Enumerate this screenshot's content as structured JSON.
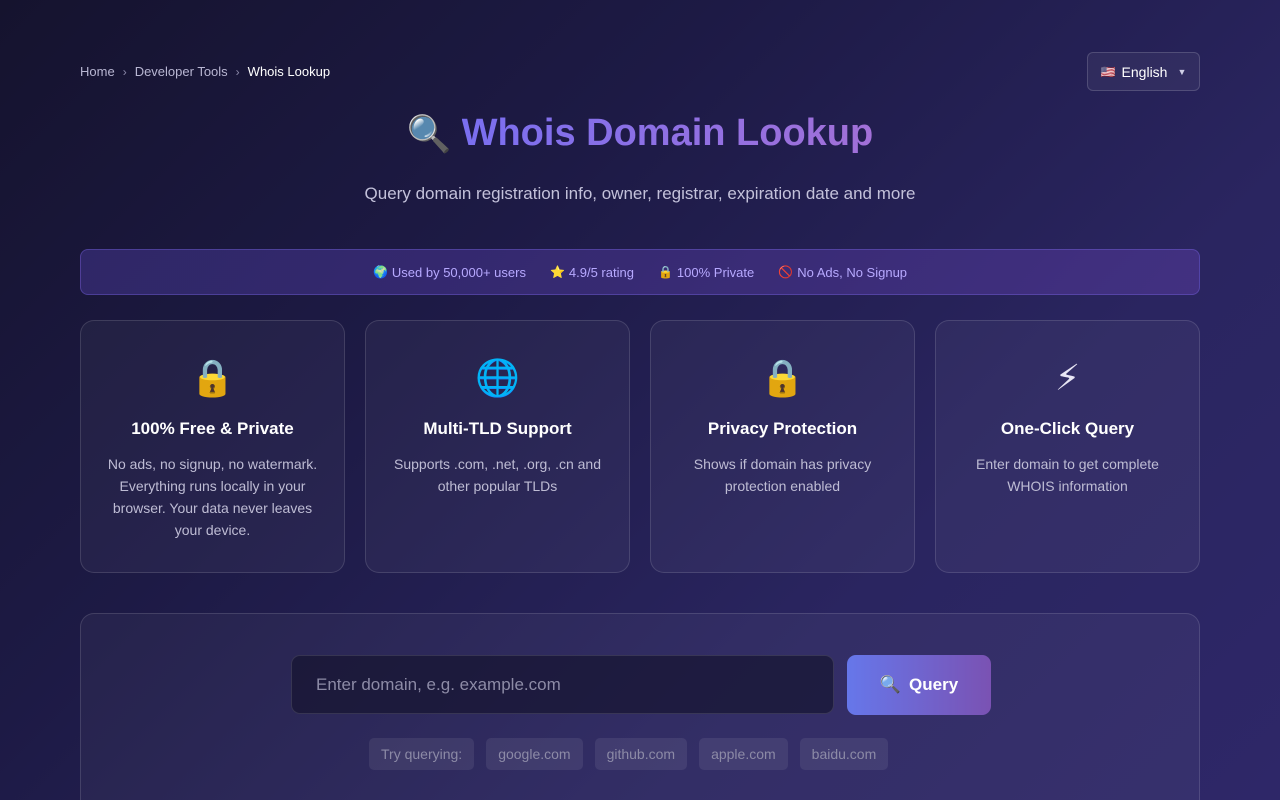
{
  "breadcrumb": {
    "items": [
      "Home",
      "Developer Tools"
    ],
    "current": "Whois Lookup",
    "separator": "›"
  },
  "language": {
    "flag": "🇺🇸",
    "label": "English",
    "caret": "▼"
  },
  "header": {
    "title_icon": "🔍",
    "title": "Whois Domain Lookup",
    "subtitle": "Query domain registration info, owner, registrar, expiration date and more"
  },
  "trust": [
    {
      "icon": "🌍",
      "label": "Used by 50,000+ users"
    },
    {
      "icon": "⭐",
      "label": "4.9/5 rating"
    },
    {
      "icon": "🔒",
      "label": "100% Private"
    },
    {
      "icon": "🚫",
      "label": "No Ads, No Signup"
    }
  ],
  "features": [
    {
      "icon": "🔒",
      "icon_name": "lock-icon",
      "title": "100% Free & Private",
      "desc": "No ads, no signup, no watermark. Everything runs locally in your browser. Your data never leaves your device."
    },
    {
      "icon": "🌐",
      "icon_name": "globe-icon",
      "title": "Multi-TLD Support",
      "desc": "Supports .com, .net, .org, .cn and other popular TLDs"
    },
    {
      "icon": "🔒",
      "icon_name": "lock-icon",
      "title": "Privacy Protection",
      "desc": "Shows if domain has privacy protection enabled"
    },
    {
      "icon": "⚡",
      "icon_name": "lightning-icon",
      "title": "One-Click Query",
      "desc": "Enter domain to get complete WHOIS information"
    }
  ],
  "search": {
    "placeholder": "Enter domain, e.g. example.com",
    "value": "",
    "button_icon": "🔍",
    "button_label": "Query",
    "try_label": "Try querying:",
    "examples": [
      "google.com",
      "github.com",
      "apple.com",
      "baidu.com"
    ]
  },
  "colors": {
    "accent_start": "#6677ea",
    "accent_end": "#7a52b3",
    "trust_text": "#b7a9ff"
  }
}
